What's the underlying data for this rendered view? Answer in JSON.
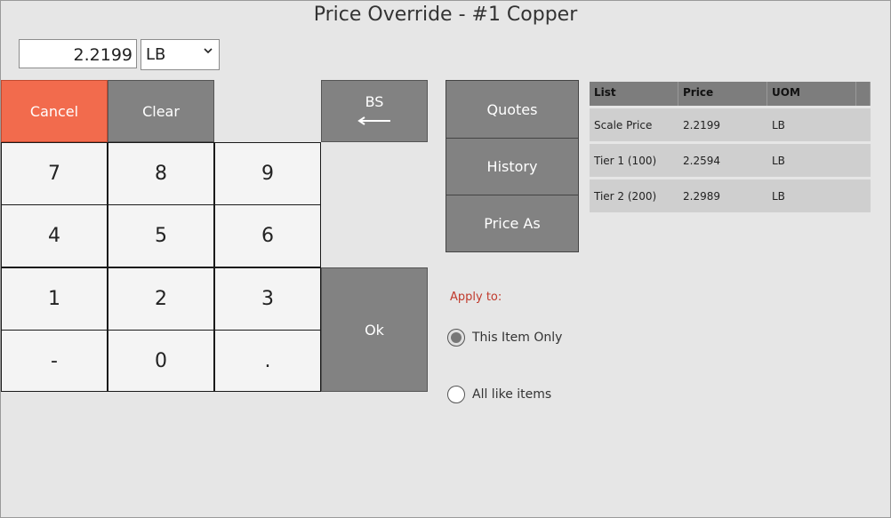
{
  "window": {
    "title": "Price Override - #1 Copper"
  },
  "entry": {
    "value": "2.2199",
    "uom_selected": "LB"
  },
  "keypad": {
    "cancel": "Cancel",
    "clear": "Clear",
    "bs": "BS",
    "ok": "Ok",
    "keys": [
      "7",
      "8",
      "9",
      "4",
      "5",
      "6",
      "1",
      "2",
      "3",
      "-",
      "0",
      "."
    ]
  },
  "side_buttons": {
    "quotes": "Quotes",
    "history": "History",
    "price_as": "Price As"
  },
  "apply": {
    "label": "Apply to:",
    "options": [
      {
        "label": "This Item Only",
        "selected": true
      },
      {
        "label": "All like items",
        "selected": false
      }
    ]
  },
  "price_table": {
    "columns": [
      "List",
      "Price",
      "UOM"
    ],
    "rows": [
      [
        "Scale Price",
        "2.2199",
        "LB"
      ],
      [
        "Tier 1 (100)",
        "2.2594",
        "LB"
      ],
      [
        "Tier 2 (200)",
        "2.2989",
        "LB"
      ]
    ]
  },
  "colors": {
    "cancel": "#f26b4d",
    "button_gray": "#828282",
    "apply_label": "#c0392b"
  }
}
